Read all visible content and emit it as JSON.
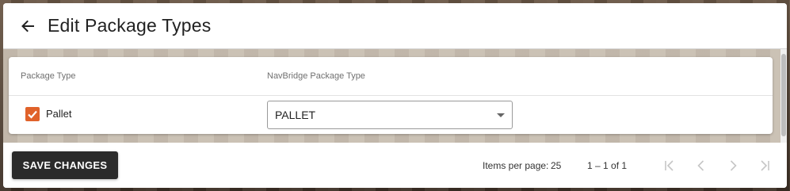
{
  "header": {
    "title": "Edit Package Types",
    "back_icon": "arrow-left-icon"
  },
  "table": {
    "columns": [
      "Package Type",
      "NavBridge Package Type"
    ],
    "rows": [
      {
        "checked": true,
        "package_type": "Pallet",
        "navbridge_type": "PALLET"
      }
    ]
  },
  "footer": {
    "save_label": "SAVE CHANGES",
    "items_per_page_label": "Items per page:",
    "items_per_page_value": "25",
    "range_label": "1 – 1 of 1"
  },
  "colors": {
    "accent": "#e0622a",
    "button_dark": "#2b2b2b"
  }
}
